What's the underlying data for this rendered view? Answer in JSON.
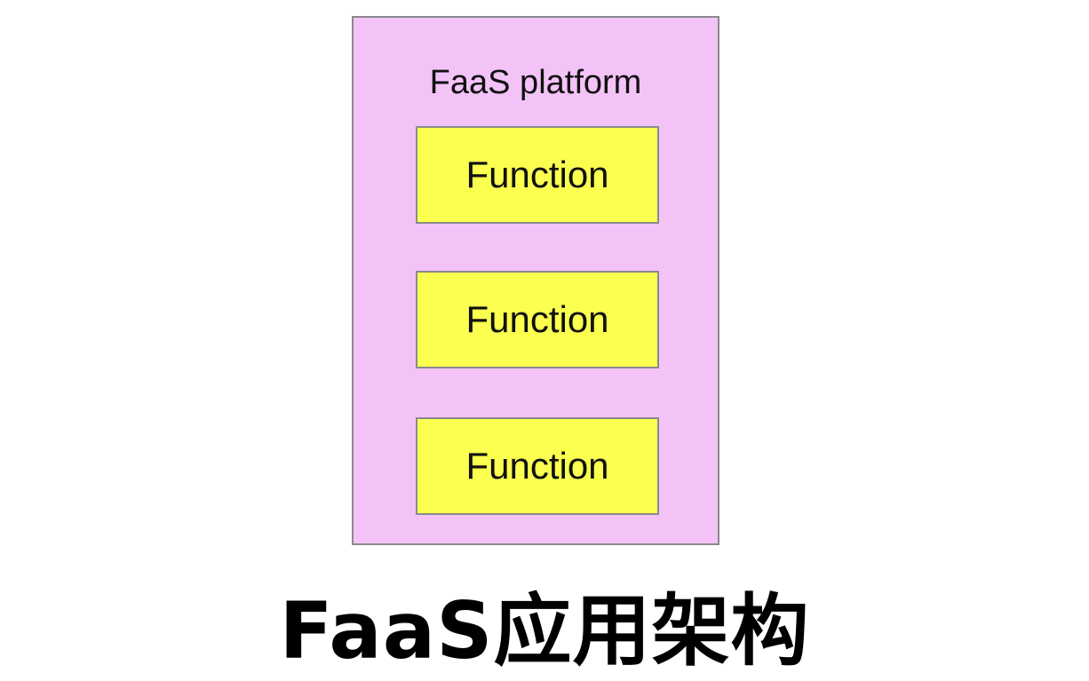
{
  "diagram": {
    "platform": {
      "title": "FaaS platform",
      "fill_color": "#f3c3f8",
      "border_color": "#8a8a8a"
    },
    "functions": [
      {
        "label": "Function"
      },
      {
        "label": "Function"
      },
      {
        "label": "Function"
      }
    ],
    "function_fill_color": "#fbff4f"
  },
  "caption": "FaaS应用架构"
}
